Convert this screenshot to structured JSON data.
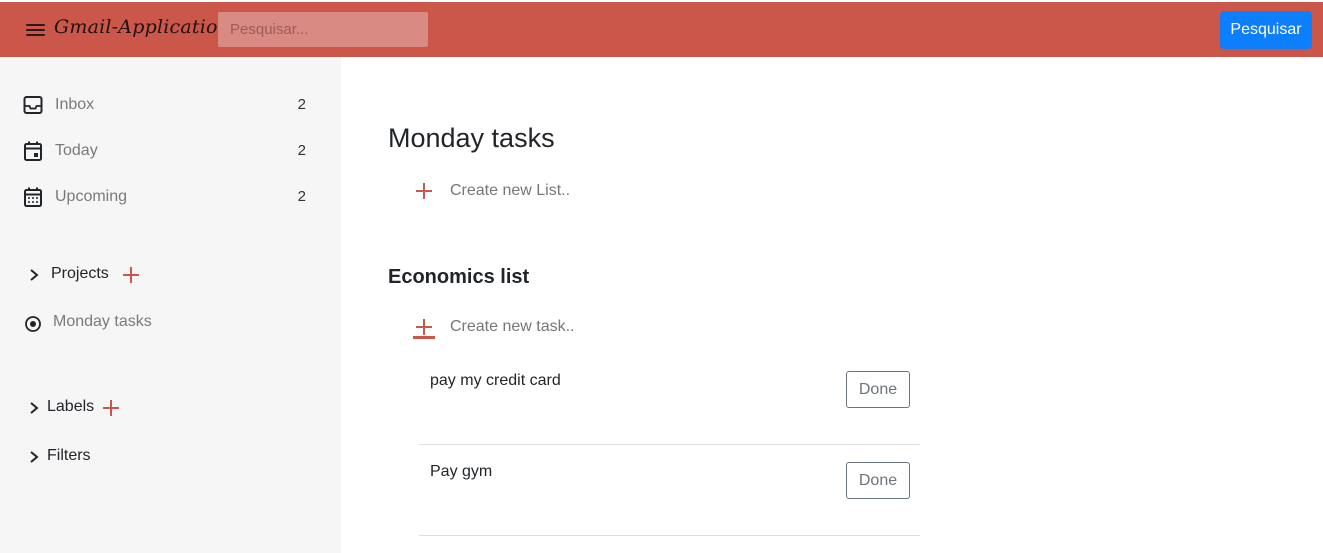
{
  "header": {
    "app_title": "Gmail-Application",
    "search_placeholder": "Pesquisar...",
    "search_button": "Pesquisar",
    "accent_color": "#cb574b",
    "button_color": "#0d7efc"
  },
  "sidebar": {
    "items": [
      {
        "icon": "inbox-icon",
        "label": "Inbox",
        "count": "2"
      },
      {
        "icon": "calendar-today-icon",
        "label": "Today",
        "count": "2"
      },
      {
        "icon": "calendar-upcoming-icon",
        "label": "Upcoming",
        "count": "2"
      }
    ],
    "projects_label": "Projects",
    "project_items": [
      {
        "icon": "radio-dot-icon",
        "label": "Monday tasks"
      }
    ],
    "labels_label": "Labels",
    "filters_label": "Filters"
  },
  "main": {
    "page_title": "Monday tasks",
    "create_list_label": "Create new List..",
    "list": {
      "title": "Economics list",
      "create_task_label": "Create new task..",
      "tasks": [
        {
          "text": "pay my credit card",
          "button": "Done"
        },
        {
          "text": "Pay gym",
          "button": "Done"
        }
      ]
    }
  }
}
